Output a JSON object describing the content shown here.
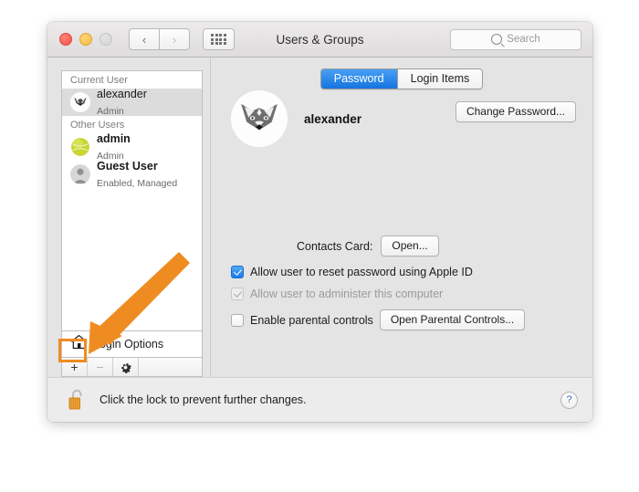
{
  "window": {
    "title": "Users & Groups",
    "traffic_lights": [
      "close-red",
      "minimize-yellow",
      "zoom-disabled"
    ],
    "nav": {
      "back": "‹",
      "forward": "›"
    },
    "show_all_icon": "grid-icon"
  },
  "search": {
    "placeholder": "Search",
    "icon": "search-icon"
  },
  "sidebar": {
    "groups": [
      {
        "header": "Current User",
        "users": [
          {
            "name": "alexander",
            "sub": "Admin",
            "avatar": "fox-avatar",
            "selected": true
          }
        ]
      },
      {
        "header": "Other Users",
        "users": [
          {
            "name": "admin",
            "sub": "Admin",
            "avatar": "tennis-ball-avatar",
            "selected": false
          },
          {
            "name": "Guest User",
            "sub": "Enabled, Managed",
            "avatar": "person-avatar",
            "selected": false
          }
        ]
      }
    ],
    "login_options": {
      "label": "Login Options",
      "icon": "house-icon"
    },
    "buttons": {
      "add": "+",
      "remove": "−",
      "settings": "gear-icon"
    }
  },
  "main": {
    "tabs": [
      {
        "label": "Password",
        "active": true
      },
      {
        "label": "Login Items",
        "active": false
      }
    ],
    "user": {
      "name": "alexander",
      "avatar": "fox-avatar"
    },
    "change_password_label": "Change Password...",
    "contacts_card": {
      "label": "Contacts Card:",
      "button": "Open..."
    },
    "checkboxes": [
      {
        "label": "Allow user to reset password using Apple ID",
        "checked": true,
        "disabled": false
      },
      {
        "label": "Allow user to administer this computer",
        "checked": true,
        "disabled": true
      },
      {
        "label": "Enable parental controls",
        "checked": false,
        "disabled": false
      }
    ],
    "parental_controls_button": "Open Parental Controls..."
  },
  "footer": {
    "lock_icon": "unlocked-padlock-icon",
    "message": "Click the lock to prevent further changes.",
    "help": "?"
  },
  "annotation": {
    "arrow_color": "#ef8c21",
    "highlight_color": "#ef8c21",
    "points_to": "add-user-button"
  }
}
